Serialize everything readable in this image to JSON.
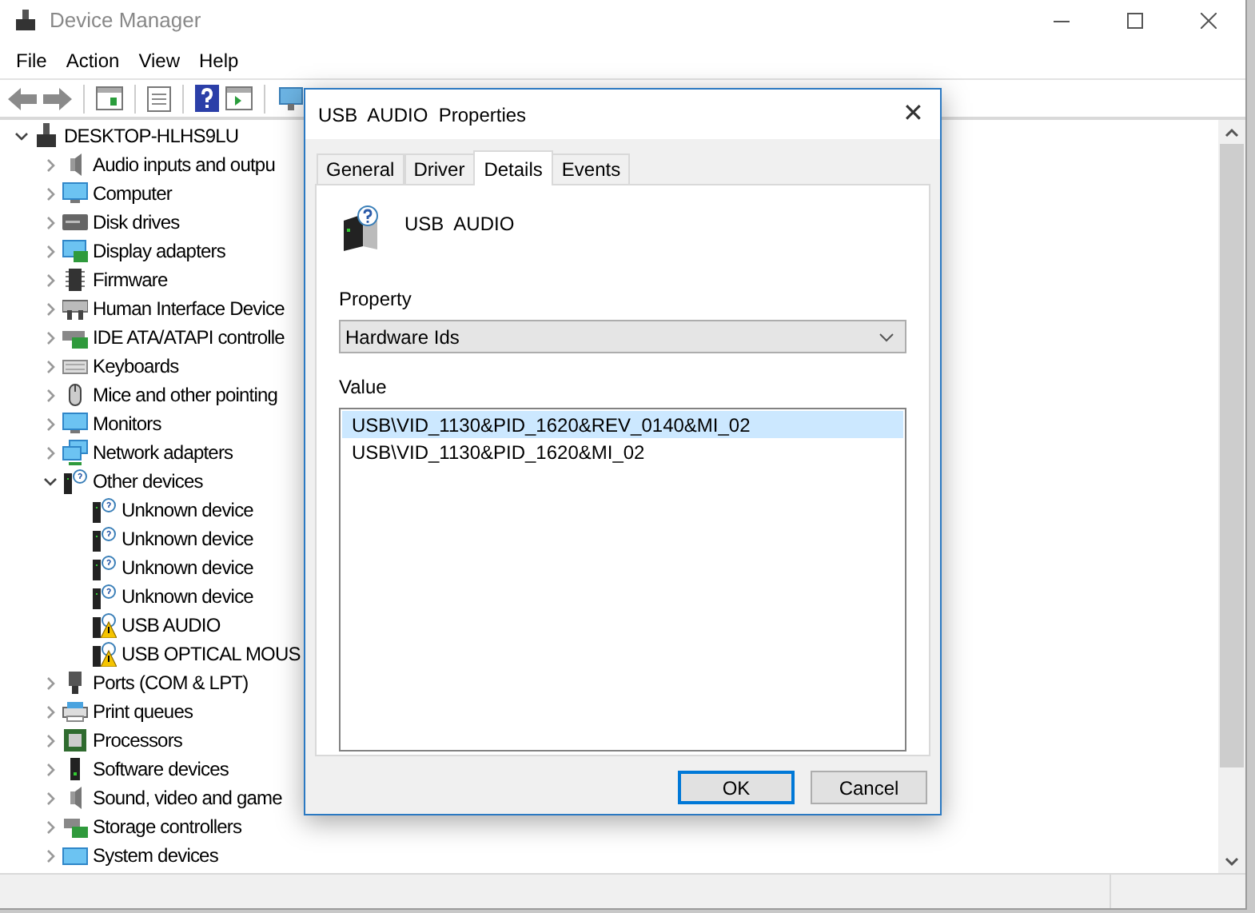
{
  "window": {
    "title": "Device Manager"
  },
  "menu": [
    "File",
    "Action",
    "View",
    "Help"
  ],
  "tree": {
    "label": "DESKTOP-HLHS9LU",
    "kind": "computer",
    "expanded": true,
    "children": [
      {
        "label": "Audio inputs and outpu",
        "kind": "speaker",
        "expanded": false
      },
      {
        "label": "Computer",
        "kind": "monitor",
        "expanded": false
      },
      {
        "label": "Disk drives",
        "kind": "disk",
        "expanded": false
      },
      {
        "label": "Display adapters",
        "kind": "display",
        "expanded": false
      },
      {
        "label": "Firmware",
        "kind": "chip",
        "expanded": false
      },
      {
        "label": "Human Interface Device",
        "kind": "hid",
        "expanded": false
      },
      {
        "label": "IDE ATA/ATAPI controlle",
        "kind": "ide",
        "expanded": false
      },
      {
        "label": "Keyboards",
        "kind": "keyboard",
        "expanded": false
      },
      {
        "label": "Mice and other pointing",
        "kind": "mouse",
        "expanded": false
      },
      {
        "label": "Monitors",
        "kind": "monitor",
        "expanded": false
      },
      {
        "label": "Network adapters",
        "kind": "network",
        "expanded": false
      },
      {
        "label": "Other devices",
        "kind": "unknown",
        "expanded": true,
        "children": [
          {
            "label": "Unknown device",
            "kind": "unknown"
          },
          {
            "label": "Unknown device",
            "kind": "unknown"
          },
          {
            "label": "Unknown device",
            "kind": "unknown"
          },
          {
            "label": "Unknown device",
            "kind": "unknown"
          },
          {
            "label": "USB  AUDIO",
            "kind": "warning"
          },
          {
            "label": "USB OPTICAL MOUS",
            "kind": "warning"
          }
        ]
      },
      {
        "label": "Ports (COM & LPT)",
        "kind": "port",
        "expanded": false
      },
      {
        "label": "Print queues",
        "kind": "printer",
        "expanded": false
      },
      {
        "label": "Processors",
        "kind": "processor",
        "expanded": false
      },
      {
        "label": "Software devices",
        "kind": "software",
        "expanded": false
      },
      {
        "label": "Sound, video and game",
        "kind": "speaker",
        "expanded": false
      },
      {
        "label": "Storage controllers",
        "kind": "storage",
        "expanded": false
      },
      {
        "label": "System devices",
        "kind": "system",
        "expanded": false
      }
    ]
  },
  "dialog": {
    "title": "USB  AUDIO  Properties",
    "close": "✕",
    "tabs": [
      {
        "label": "General",
        "selected": false
      },
      {
        "label": "Driver",
        "selected": false
      },
      {
        "label": "Details",
        "selected": true
      },
      {
        "label": "Events",
        "selected": false
      }
    ],
    "device_name": "USB  AUDIO",
    "property_label": "Property",
    "property_value": "Hardware Ids",
    "value_label": "Value",
    "values": [
      {
        "text": "USB\\VID_1130&PID_1620&REV_0140&MI_02",
        "selected": true
      },
      {
        "text": "USB\\VID_1130&PID_1620&MI_02",
        "selected": false
      }
    ],
    "buttons": [
      {
        "label": "OK",
        "default": true
      },
      {
        "label": "Cancel",
        "default": false
      }
    ]
  }
}
